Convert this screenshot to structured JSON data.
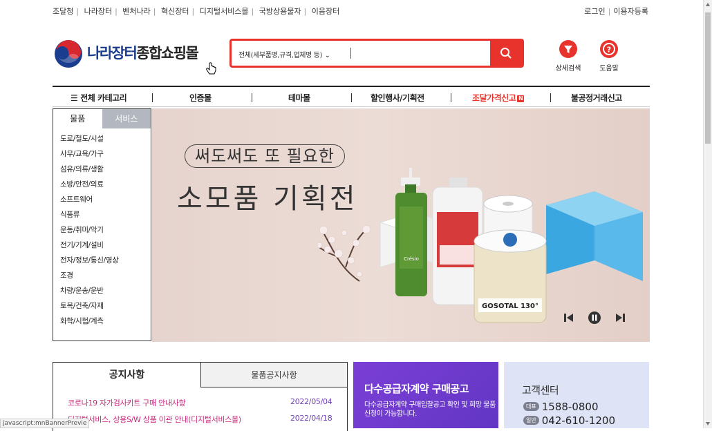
{
  "top_links": [
    "조달청",
    "나라장터",
    "벤처나라",
    "혁신장터",
    "디지털서비스몰",
    "국방상용물자",
    "이음장터"
  ],
  "account": {
    "login": "로그인",
    "register": "이용자등록"
  },
  "logo": {
    "part1": "나라장터",
    "part2": "종합쇼핑몰"
  },
  "search": {
    "selector": "전체(세부품명,규격,업체명 등)",
    "value": ""
  },
  "header_icons": {
    "detail_search": "상세검색",
    "help": "도움말"
  },
  "nav": {
    "all_categories": "전체 카테고리",
    "items": [
      "인증몰",
      "테마몰",
      "할인행사/기획전",
      "조달가격신고",
      "불공정거래신고"
    ],
    "new_badge": "N"
  },
  "sidebar": {
    "tabs": [
      "물품",
      "서비스"
    ],
    "items": [
      "도로/철도/시설",
      "사무/교육/가구",
      "섬유/의류/생활",
      "소방/안전/의료",
      "소프트웨어",
      "식품류",
      "운동/취미/악기",
      "전기/기계/설비",
      "전자/정보/통신/영상",
      "조경",
      "차량/운송/운반",
      "토목/건축/자재",
      "화학/시험/계측"
    ]
  },
  "banner": {
    "tagline": "써도써도 또 필요한",
    "headline": "소모품 기획전",
    "product_labels": {
      "gosotal": "GOSOTAL 130°",
      "cresio": "Crésio"
    }
  },
  "notice": {
    "tabs": [
      "공지사항",
      "물품공지사항"
    ],
    "rows": [
      {
        "title": "코로나19 자가검사키트 구매 안내사항",
        "date": "2022/05/04"
      },
      {
        "title": "디지털서비스, 상용S/W 상품 이관 안내(디지털서비스몰)",
        "date": "2022/04/18"
      }
    ]
  },
  "promo": {
    "title": "다수공급자계약 구매공고",
    "desc": "다수공급자계약 구매입찰공고 확인 및 희망 물품 신청이 가능합니다."
  },
  "customer_center": {
    "title": "고객센터",
    "rep_tag": "대표",
    "rep_phone": "1588-0800",
    "gen_tag": "일반",
    "gen_phone": "042-610-1200"
  },
  "status_bar": "javascript:mnBannerPrevie",
  "colors": {
    "brand_red": "#e8332c",
    "promo_purple": "#6f3cd0",
    "nav_hot": "#e8332c",
    "notice_link": "#c7287a"
  }
}
